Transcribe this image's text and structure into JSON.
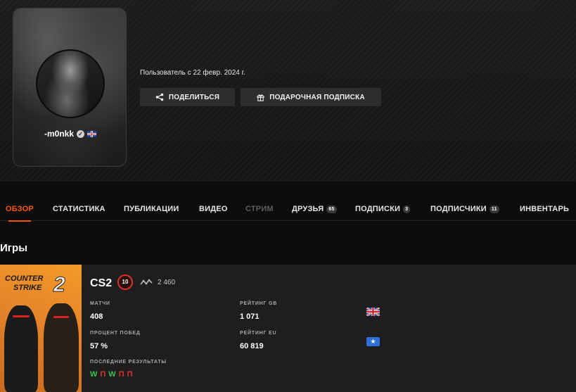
{
  "profile": {
    "username": "-m0nkk",
    "member_since": "Пользователь с 22 февр. 2024 г.",
    "share_label": "ПОДЕЛИТЬСЯ",
    "gift_label": "ПОДАРОЧНАЯ ПОДПИСКА"
  },
  "tabs": [
    {
      "label": "ОБЗОР",
      "state": "active"
    },
    {
      "label": "СТАТИСТИКА"
    },
    {
      "label": "ПУБЛИКАЦИИ"
    },
    {
      "label": "ВИДЕО"
    },
    {
      "label": "СТРИМ",
      "state": "disabled"
    },
    {
      "label": "ДРУЗЬЯ",
      "badge": "65"
    },
    {
      "label": "ПОДПИСКИ",
      "badge": "3"
    },
    {
      "label": "ПОДПИСЧИКИ",
      "badge": "11"
    },
    {
      "label": "ИНВЕНТАРЬ"
    }
  ],
  "games_section": {
    "title": "Игры",
    "cover": {
      "logo_line1": "COUNTER",
      "logo_line2": "STRIKE",
      "logo_number": "2"
    },
    "game": {
      "name": "CS2",
      "level": "10",
      "elo": "2 460",
      "matches_label": "МАТЧИ",
      "matches": "408",
      "winrate_label": "ПРОЦЕНТ ПОБЕД",
      "winrate": "57 %",
      "recent_label": "ПОСЛЕДНИЕ РЕЗУЛЬТАТЫ",
      "recent_results": [
        "W",
        "П",
        "W",
        "П",
        "П"
      ],
      "rating_gb_label": "РЕЙТИНГ GB",
      "rating_gb": "1 071",
      "rating_eu_label": "РЕЙТИНГ EU",
      "rating_eu": "60 819"
    }
  },
  "colors": {
    "accent": "#ff5500",
    "win": "#3ac44e",
    "loss": "#e0302a",
    "level_ring": "#e0302a"
  },
  "icons": [
    "verified-icon",
    "uk-flag-icon",
    "share-icon",
    "gift-icon",
    "level-10-icon",
    "elo-trend-icon",
    "eu-flag-icon"
  ]
}
